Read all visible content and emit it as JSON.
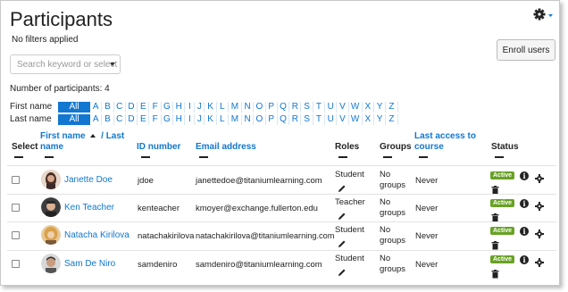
{
  "page": {
    "title": "Participants",
    "filters_text": "No filters applied",
    "enroll_label": "Enroll users",
    "search_placeholder": "Search keyword or select fi",
    "participants_count": "Number of participants: 4"
  },
  "initials": {
    "first_label": "First name",
    "last_label": "Last name",
    "all_label": "All",
    "letters": [
      "A",
      "B",
      "C",
      "D",
      "E",
      "F",
      "G",
      "H",
      "I",
      "J",
      "K",
      "L",
      "M",
      "N",
      "O",
      "P",
      "Q",
      "R",
      "S",
      "T",
      "U",
      "V",
      "W",
      "X",
      "Y",
      "Z"
    ]
  },
  "table": {
    "headers": {
      "select": "Select",
      "firstname_line1": "First name",
      "firstname_sep": "/ Last",
      "firstname_line2": "name",
      "idnumber": "ID number",
      "email": "Email address",
      "roles": "Roles",
      "groups": "Groups",
      "lastaccess_line1": "Last access to",
      "lastaccess_line2": "course",
      "status": "Status"
    },
    "rows": [
      {
        "name": "Janette Doe",
        "idnumber": "jdoe",
        "email": "janettedoe@titaniumlearning.com",
        "role": "Student",
        "groups_line1": "No",
        "groups_line2": "groups",
        "lastaccess": "Never",
        "status": "Active"
      },
      {
        "name": "Ken Teacher",
        "idnumber": "kenteacher",
        "email": "kmoyer@exchange.fullerton.edu",
        "role": "Teacher",
        "groups_line1": "No",
        "groups_line2": "groups",
        "lastaccess": "Never",
        "status": "Active"
      },
      {
        "name": "Natacha Kirilova",
        "idnumber": "natachakirilova",
        "email": "natachakirilova@titaniumlearning.com",
        "role": "Student",
        "groups_line1": "No",
        "groups_line2": "groups",
        "lastaccess": "Never",
        "status": "Active"
      },
      {
        "name": "Sam De Niro",
        "idnumber": "samdeniro",
        "email": "samdeniro@titaniumlearning.com",
        "role": "Student",
        "groups_line1": "No",
        "groups_line2": "groups",
        "lastaccess": "Never",
        "status": "Active"
      }
    ]
  },
  "icons": {
    "gear": "gear-icon",
    "info": "info-icon",
    "cog": "cog-icon",
    "pencil": "pencil-icon",
    "trash": "trash-icon",
    "sort": "sort-up-icon"
  },
  "colors": {
    "link": "#1177d1",
    "active_badge": "#68a225"
  }
}
